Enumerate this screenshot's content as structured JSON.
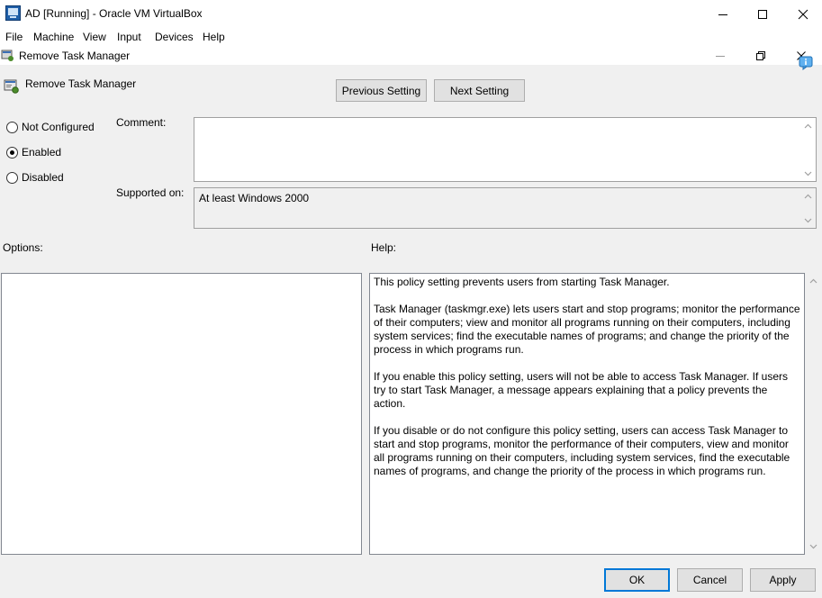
{
  "window": {
    "title": "AD [Running] - Oracle VM VirtualBox",
    "icon": "virtualbox-icon",
    "controls": [
      "minimize-icon",
      "maximize-icon",
      "close-icon"
    ]
  },
  "menu": [
    "File",
    "Machine",
    "View",
    "Input",
    "Devices",
    "Help"
  ],
  "dialog": {
    "title": "Remove Task Manager",
    "icon": "policy-icon",
    "controls": [
      "minimize-icon",
      "restore-icon",
      "close-icon"
    ],
    "header": "Remove Task Manager",
    "prev_button": "Previous Setting",
    "next_button": "Next Setting",
    "options": {
      "not_configured": "Not Configured",
      "enabled": "Enabled",
      "disabled": "Disabled",
      "selected": "enabled"
    },
    "comment_label": "Comment:",
    "comment_value": "",
    "supported_label": "Supported on:",
    "supported_value": "At least Windows 2000",
    "options_label": "Options:",
    "help_label": "Help:",
    "help": [
      "This policy setting prevents users from starting Task Manager.",
      "Task Manager (taskmgr.exe) lets users start and stop programs; monitor the performance of their computers; view and monitor all programs running on their computers, including system services; find the executable names of programs; and change the priority of the process in which programs run.",
      "If you enable this policy setting, users will not be able to access Task Manager. If users try to start Task Manager, a message appears explaining that a policy prevents the action.",
      "If you disable or do not configure this policy setting, users can access Task Manager to start and stop programs, monitor the performance of their computers, view and monitor all programs running on their computers, including system services, find the executable names of programs, and change the priority of the process in which programs run."
    ],
    "ok_button": "OK",
    "cancel_button": "Cancel",
    "apply_button": "Apply"
  },
  "colors": {
    "accent": "#0078d7",
    "background": "#f0f0f0"
  }
}
